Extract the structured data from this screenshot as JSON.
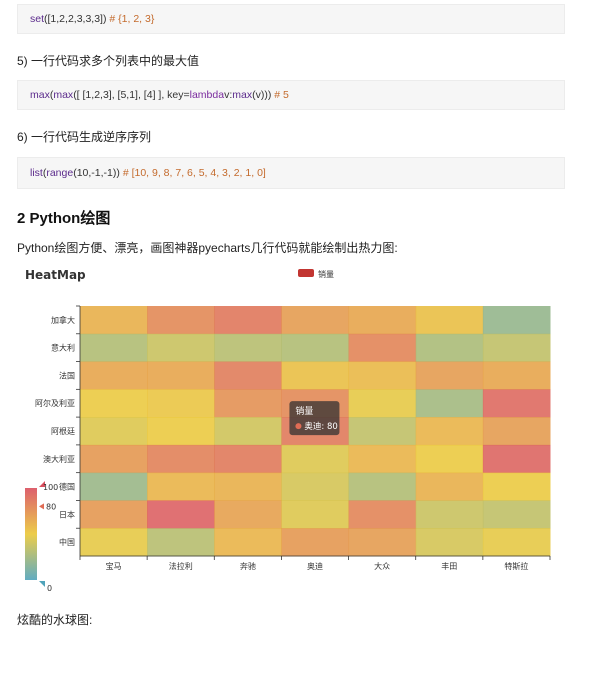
{
  "code1": {
    "fn": "set",
    "args": "([1,2,2,3,3,3])",
    "comment": "# {1, 2, 3}"
  },
  "heading5": "5) 一行代码求多个列表中的最大值",
  "code2": {
    "fn_outer": "max",
    "p1": "(",
    "fn_inner": "max",
    "p2": "([ [1,2,3], [5,1], [4] ], key=",
    "kw": "lambda",
    "p3": " v: ",
    "fn_inner2": "max",
    "p4": "(v)))",
    "comment": "# 5"
  },
  "heading6": "6) 一行代码生成逆序序列",
  "code3": {
    "fn": "list",
    "p1": "(",
    "fn2": "range",
    "p2": "(10,-1,-1))",
    "comment": "# [10, 9, 8, 7, 6, 5, 4, 3, 2, 1, 0]"
  },
  "section_title": "2 Python绘图",
  "intro": "Python绘图方便、漂亮，画图神器pyecharts几行代码就能绘制出热力图:",
  "outro": "炫酷的水球图:",
  "chart_data": {
    "type": "heatmap",
    "title": "HeatMap",
    "legend": "销量",
    "legend_color": "#c23531",
    "x": [
      "宝马",
      "法拉利",
      "奔驰",
      "奥迪",
      "大众",
      "丰田",
      "特斯拉"
    ],
    "y": [
      "加拿大",
      "意大利",
      "法国",
      "阿尔及利亚",
      "阿根廷",
      "澳大利亚",
      "德国",
      "日本",
      "中国"
    ],
    "values": [
      [
        62,
        78,
        86,
        70,
        66,
        55,
        20
      ],
      [
        30,
        38,
        32,
        30,
        80,
        28,
        35
      ],
      [
        66,
        66,
        84,
        55,
        58,
        70,
        66
      ],
      [
        50,
        52,
        75,
        78,
        48,
        25,
        92
      ],
      [
        45,
        50,
        40,
        85,
        35,
        60,
        70
      ],
      [
        72,
        82,
        85,
        45,
        60,
        50,
        94
      ],
      [
        22,
        60,
        62,
        42,
        30,
        62,
        50
      ],
      [
        72,
        96,
        68,
        45,
        80,
        38,
        35
      ],
      [
        48,
        32,
        60,
        72,
        70,
        42,
        48
      ]
    ],
    "visual_map": {
      "min": 0,
      "max": 100,
      "max_label": "100",
      "pointer_label": "80",
      "min_label": "0",
      "colors": [
        "#50a3ba",
        "#eac736",
        "#d94e5d"
      ]
    },
    "tooltip": {
      "title": "销量",
      "label": "奥迪: 80"
    }
  }
}
